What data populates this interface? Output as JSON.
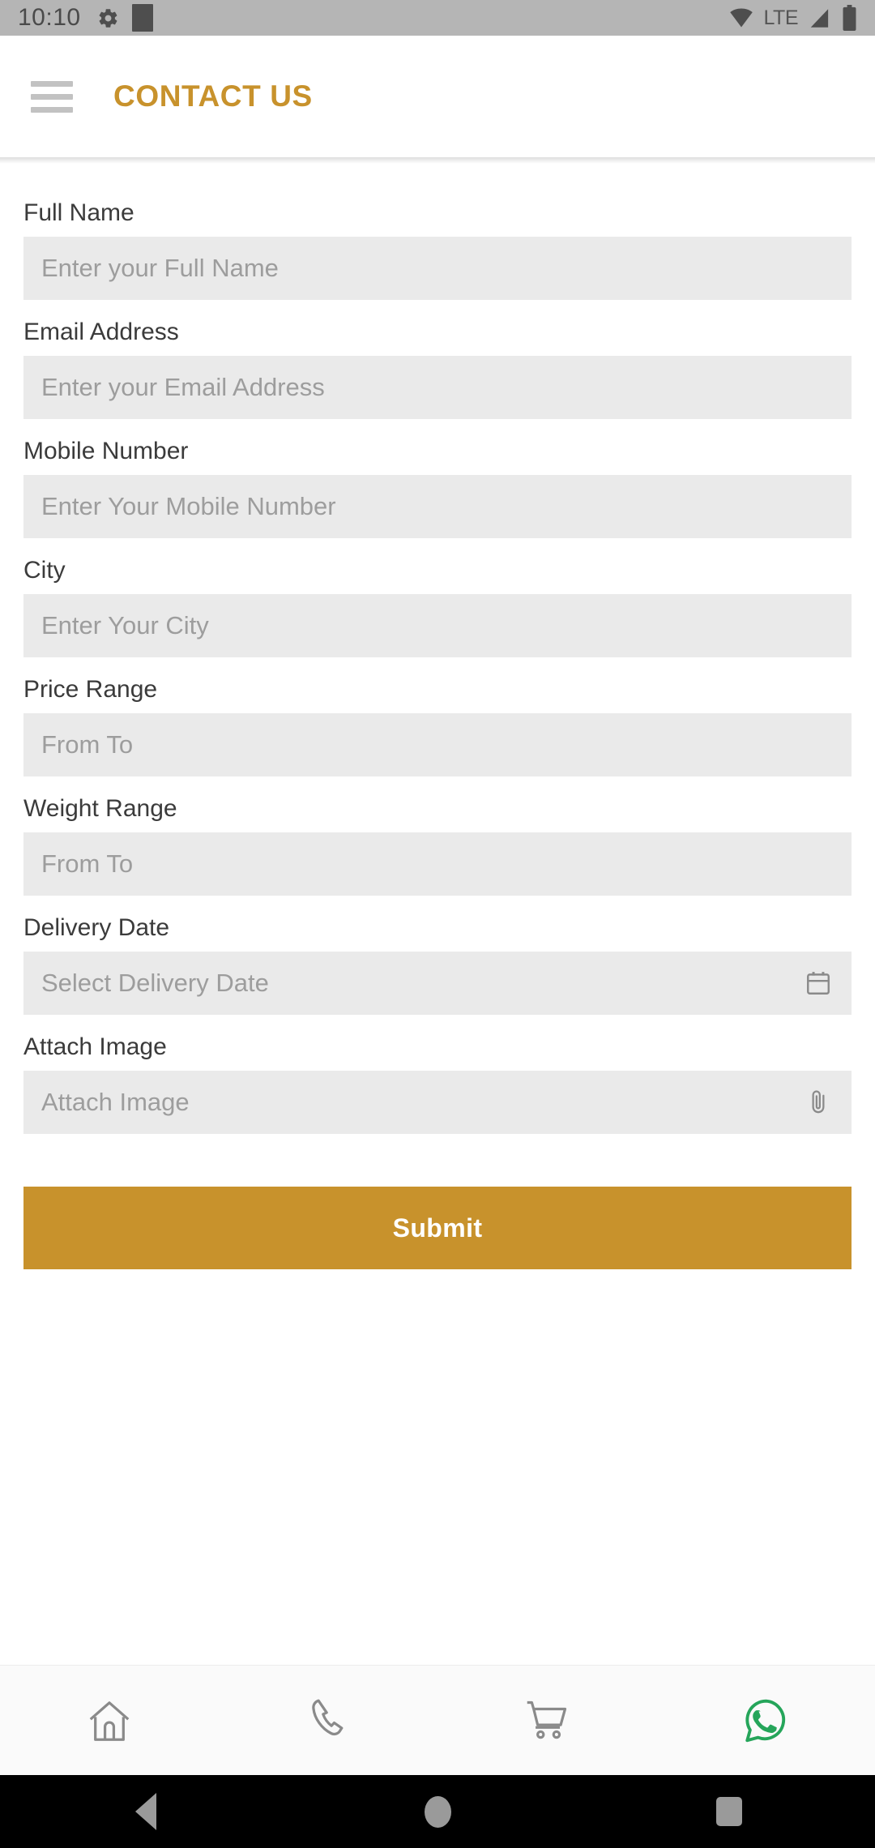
{
  "status_bar": {
    "time": "10:10",
    "gear_icon": "gear-icon",
    "block_icon": "app-indicator-icon",
    "wifi_icon": "wifi-icon",
    "network_label": "LTE",
    "signal_icon": "signal-icon",
    "battery_icon": "battery-icon"
  },
  "header": {
    "menu_icon": "hamburger-menu-icon",
    "title": "CONTACT US",
    "title_color": "#c8922c"
  },
  "form": {
    "fields": [
      {
        "label": "Full Name",
        "placeholder": "Enter your Full Name",
        "icon": ""
      },
      {
        "label": "Email Address",
        "placeholder": "Enter your Email Address",
        "icon": ""
      },
      {
        "label": "Mobile Number",
        "placeholder": "Enter Your Mobile Number",
        "icon": ""
      },
      {
        "label": "City",
        "placeholder": "Enter Your City",
        "icon": ""
      },
      {
        "label": "Price Range",
        "placeholder": "From To",
        "icon": ""
      },
      {
        "label": "Weight Range",
        "placeholder": "From To",
        "icon": ""
      },
      {
        "label": "Delivery Date",
        "placeholder": "Select Delivery Date",
        "icon": "calendar-icon"
      },
      {
        "label": "Attach Image",
        "placeholder": "Attach Image",
        "icon": "paperclip-icon"
      }
    ]
  },
  "submit": {
    "label": "Submit",
    "color": "#c8922c"
  },
  "bottom_nav": {
    "items": [
      {
        "name": "home",
        "icon": "home-icon",
        "color": "#8a8a8a"
      },
      {
        "name": "call",
        "icon": "phone-icon",
        "color": "#8a8a8a"
      },
      {
        "name": "cart",
        "icon": "cart-icon",
        "color": "#8a8a8a"
      },
      {
        "name": "whatsapp",
        "icon": "whatsapp-icon",
        "color": "#25a55a"
      }
    ]
  },
  "system_nav": {
    "back": "back-button",
    "home": "home-button",
    "recents": "recents-button"
  }
}
